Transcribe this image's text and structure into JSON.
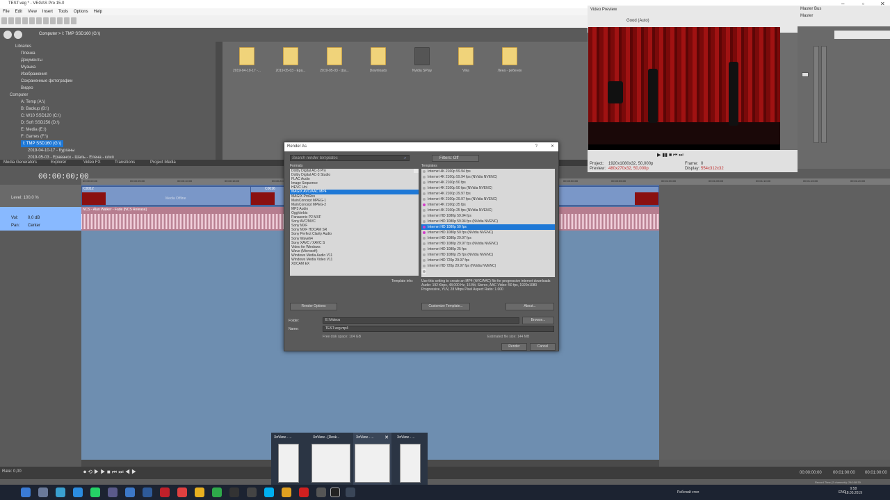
{
  "window": {
    "title": "TEST.veg * - VEGAS Pro 15.0"
  },
  "menu": [
    "File",
    "Edit",
    "View",
    "Insert",
    "Tools",
    "Options",
    "Help"
  ],
  "explorer": {
    "path": "Computer  >  I: TMP SSD160 (G:\\)",
    "tree": [
      "Libraries",
      "Пленка",
      "Документы",
      "Музыка",
      "Изображения",
      "Сохраненные фотографии",
      "Видео",
      "Computer",
      "A: Temp (A:\\)",
      "B: Backup (B:\\)",
      "C: W10 SSD120 (C:\\)",
      "D: Soft SSD256 (D:\\)",
      "E: Media (E:\\)",
      "F: Games (F:\\)"
    ],
    "tree_selected": "I: TMP SSD160 (G:\\)",
    "tree_children": [
      "2019-04-10-17 - Курганы",
      "2019-05-03 - Ераванск - Шаль - Елена - клип"
    ],
    "folders": [
      "2019-04-10-17 -...",
      "2019-05-03 - Ера...",
      "2019-05-03 - Ша...",
      "Downloads",
      "Nvidia SPlay",
      "Vika",
      "Лена - ребенок"
    ]
  },
  "dock_tabs": [
    "Media Generators",
    "Explorer",
    "Video FX",
    "Transitions",
    "Project Media"
  ],
  "preview": {
    "title": "Video Preview",
    "quality": "Good (Auto)",
    "project_label": "Project:",
    "project_value": "1920x1080x32, 50,000p",
    "preview_label": "Preview:",
    "preview_value": "480x270x32, 50,000p",
    "frame_label": "Frame:",
    "frame_value": "0",
    "display_label": "Display:",
    "display_value": "554x312x32"
  },
  "master": {
    "title": "Master Bus",
    "channel": "Master"
  },
  "timeline": {
    "timecode": "00:00:00;00",
    "ruler": [
      "00:00:00:00",
      "00:00:05:00",
      "00:00:10:00",
      "00:00:15:00",
      "00:00:20:00",
      "00:00:25:00",
      "00:00:30:00",
      "00:00:35:00",
      "00:00:40:00",
      "00:00:45:00",
      "00:00:50:00",
      "00:00:55:00",
      "00:01:00:00",
      "00:01:05:00",
      "00:01:10:00",
      "00:01:15:00",
      "00:01:20:00",
      "00:01:25:00"
    ],
    "video_level": "Level: 100,0 %",
    "clip1": "C0012",
    "clip2": "C0016",
    "media_offline": "Media Offline",
    "audio_clip": "NCS - Alan Walker - Fade [NCS Release]",
    "vol_label": "Vol:",
    "vol_value": "0,0 dB",
    "pan_label": "Pan:",
    "pan_value": "Center",
    "rate": "Rate: 0,00",
    "end_timecode": "00:00:00:00",
    "end_timecode2": "00:01:00:00",
    "end_timecode3": "00:01:00:00",
    "record_time": "Record Time (2 channels): 240:08:30"
  },
  "dialog": {
    "title": "Render As",
    "help": "?",
    "search_placeholder": "Search render templates",
    "filters": "Filters: Off",
    "formats_label": "Formats",
    "templates_label": "Templates",
    "formats": [
      "Dolby Digital AC-3 Pro",
      "Dolby Digital AC-3 Studio",
      "FLAC Audio",
      "Image Sequence",
      "HEVC Uni",
      "MAGIX AVC/AAC MP4",
      "MAGIX ProRes",
      "MainConcept MPEG-1",
      "MainConcept MPEG-2",
      "MP3 Audio",
      "OggVorbis",
      "Panasonic P2 MXF",
      "Sony AVC/MVC",
      "Sony MXF",
      "Sony MXF HDCAM SR",
      "Sony Perfect Clarity Audio",
      "Sony Wave64",
      "Sony XAVC / XAVC S",
      "Video for Windows",
      "Wave (Microsoft)",
      "Windows Media Audio V11",
      "Windows Media Video V11",
      "XDCAM EX"
    ],
    "format_selected": 5,
    "templates": [
      "Internet 4K 2160p 59.94 fps",
      "Internet 4K 2160p 59.94 fps (NVidia NVENC)",
      "Internet 4K 2160p 50 fps",
      "Internet 4K 2160p 50 fps (NVidia NVENC)",
      "Internet 4K 2160p 29.97 fps",
      "Internet 4K 2160p 29.97 fps (NVidia NVENC)",
      "Internet 4K 2160p 25 fps",
      "Internet 4K 2160p 25 fps (NVidia NVENC)",
      "Internet HD 1080p 59.94 fps",
      "Internet HD 1080p 59.94 fps (NVidia NVENC)",
      "Internet HD 1080p 50 fps",
      "Internet HD 1080p 50 fps (NVidia NVENC)",
      "Internet HD 1080p 29.97 fps",
      "Internet HD 1080p 29.97 fps (NVidia NVENC)",
      "Internet HD 1080p 25 fps",
      "Internet HD 1080p 25 fps (NVidia NVENC)",
      "Internet HD 720p 29.97 fps",
      "Internet HD 720p 29.97 fps (NVidia NVENC)"
    ],
    "template_selected": 10,
    "template_info_label": "Template info:",
    "template_info": "Use this setting to create an MP4 (AVC/AAC) file for progressive internet downloads Audio: 192 Kbps, 48,000 Hz, 16 Bit, Stereo, AAC Video: 50 fps, 1920x1080 Progressive, YUV, 28 Mbps Pixel Aspect Ratio: 1.000",
    "render_options": "Render Options",
    "customize": "Customize Template...",
    "about": "About...",
    "folder_label": "Folder:",
    "folder_value": "E:\\Videos",
    "browse": "Browse...",
    "name_label": "Name:",
    "name_value": "TEST.veg.mp4",
    "free_space": "Free disk space: 104 GB",
    "est_size": "Estimated file size: 144 MB",
    "render": "Render",
    "cancel": "Cancel"
  },
  "taskbar": {
    "thumbs": [
      "XnView - ...",
      "XnView - [Desk...",
      "XnView - ...",
      "XnView - ..."
    ],
    "desktop": "Рабочий стол",
    "lang": "ENG",
    "time": "9:58",
    "date": "18.05.2019"
  }
}
